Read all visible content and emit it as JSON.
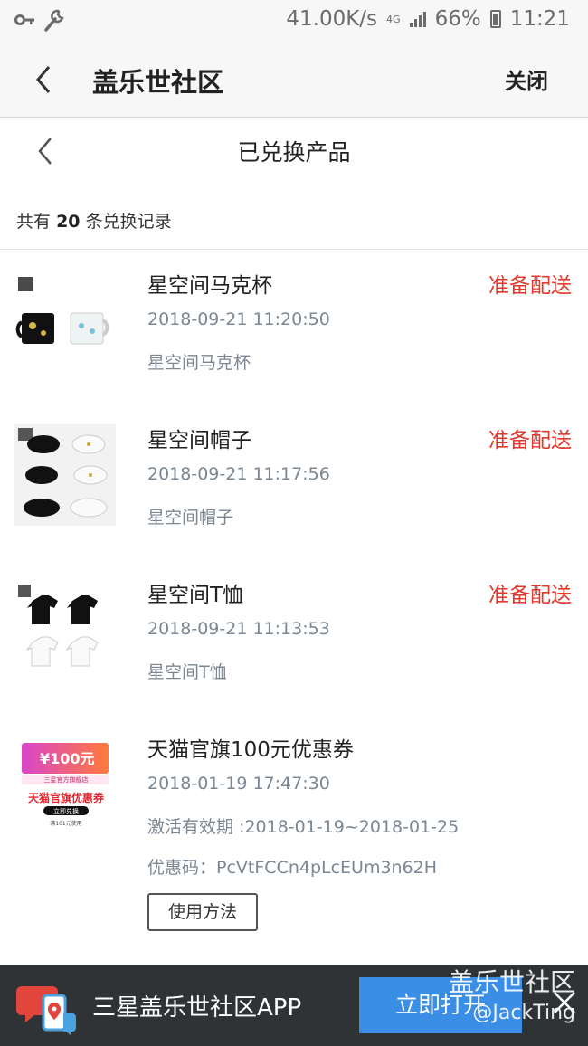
{
  "status_bar": {
    "speed": "41.00K/s",
    "network": "4G",
    "battery": "66%",
    "time": "11:21",
    "icons": [
      "key-icon",
      "wrench-icon",
      "signal-icon",
      "battery-icon"
    ]
  },
  "titlebar": {
    "title": "盖乐世社区",
    "close_label": "关闭"
  },
  "subheader": {
    "title": "已兑换产品"
  },
  "summary": {
    "prefix": "共有",
    "count": "20",
    "suffix": "条兑换记录"
  },
  "items": [
    {
      "name": "星空间马克杯",
      "status": "准备配送",
      "date": "2018-09-21 11:20:50",
      "desc": "星空间马克杯"
    },
    {
      "name": "星空间帽子",
      "status": "准备配送",
      "date": "2018-09-21 11:17:56",
      "desc": "星空间帽子"
    },
    {
      "name": "星空间T恤",
      "status": "准备配送",
      "date": "2018-09-21 11:13:53",
      "desc": "星空间T恤"
    },
    {
      "name": "天猫官旗100元优惠券",
      "status": "",
      "date": "2018-01-19 17:47:30",
      "desc": "激活有效期 :2018-01-19~2018-01-25",
      "code": "优惠码：PcVtFCCn4pLcEUm3n62H",
      "button": "使用方法"
    }
  ],
  "coupon_image": {
    "amount": "¥100元",
    "store": "三星官方旗舰店",
    "title": "天猫官旗优惠券",
    "action": "立即兑换",
    "note": "满101元使用"
  },
  "banner": {
    "app_name": "三星盖乐世社区APP",
    "open_label": "立即打开"
  },
  "watermark": {
    "line1": "盖乐世社区",
    "line2": "@JackTing"
  },
  "colors": {
    "status_red": "#e23a2e",
    "gray_text": "#7b8793",
    "banner_bg": "#303336",
    "open_btn": "#3a8ee6"
  }
}
